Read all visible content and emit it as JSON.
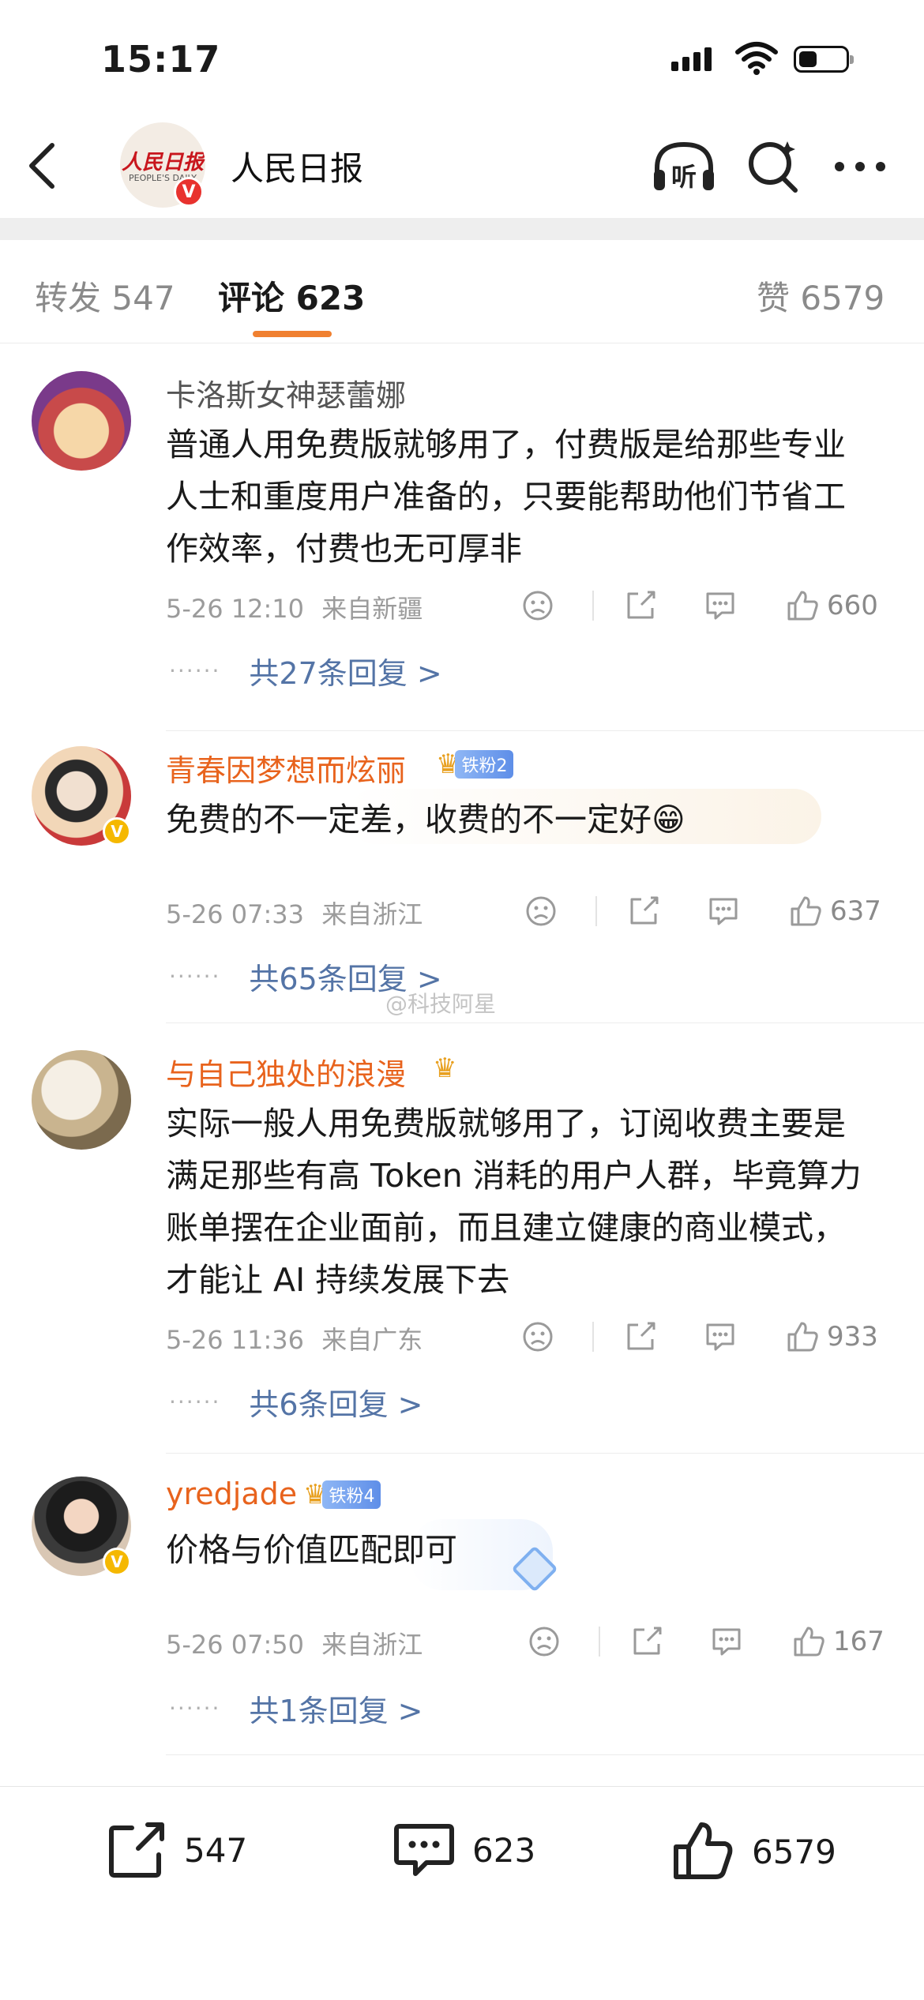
{
  "status": {
    "time": "15:17"
  },
  "nav": {
    "account_name": "人民日报",
    "logo_text": "人民日报",
    "logo_sub": "PEOPLE'S DAILY",
    "verified_mark": "V"
  },
  "tabs": [
    {
      "label": "转发",
      "count": "547"
    },
    {
      "label": "评论",
      "count": "623"
    },
    {
      "label": "赞",
      "count": "6579"
    }
  ],
  "comments": [
    {
      "name": "卡洛斯女神瑟蕾娜",
      "text": "普通人用免费版就够用了，付费版是给那些专业人士和重度用户准备的，只要能帮助他们节省工作效率，付费也无可厚非",
      "date": "5-26 12:10",
      "location": "来自新疆",
      "likes": "660",
      "replies": "共27条回复 >"
    },
    {
      "name": "青春因梦想而炫丽",
      "fan_badge": "铁粉2",
      "text": "免费的不一定差，收费的不一定好😁",
      "date": "5-26 07:33",
      "location": "来自浙江",
      "likes": "637",
      "replies": "共65条回复 >"
    },
    {
      "name": "与自己独处的浪漫",
      "text": "实际一般人用免费版就够用了，订阅收费主要是满足那些有高 Token 消耗的用户人群，毕竟算力账单摆在企业面前，而且建立健康的商业模式，才能让 AI 持续发展下去",
      "date": "5-26 11:36",
      "location": "来自广东",
      "likes": "933",
      "replies": "共6条回复 >"
    },
    {
      "name": "yredjade",
      "fan_badge": "铁粉4",
      "text": "价格与价值匹配即可",
      "date": "5-26 07:50",
      "location": "来自浙江",
      "likes": "167",
      "replies": "共1条回复 >"
    }
  ],
  "watermark": "@科技阿星",
  "bottom": {
    "repost_count": "547",
    "comment_count": "623",
    "like_count": "6579"
  },
  "colors": {
    "accent_orange": "#f08030",
    "name_orange": "#e8631d",
    "reply_blue": "#5474a6",
    "verified_red": "#e8322e",
    "verified_gold": "#f5b800"
  }
}
